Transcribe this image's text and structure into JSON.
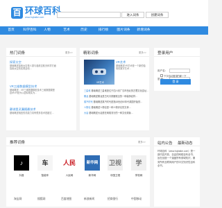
{
  "brand": {
    "name": "环球百科",
    "url": "www.hqbaike.com",
    "glyph": "百"
  },
  "search": {
    "value": "",
    "enter_label": "进入词条",
    "create_label": "创建词条"
  },
  "nav": {
    "items": [
      "首页",
      "科学百科",
      "人物",
      "艺术",
      "历史",
      "排行榜",
      "图片词条",
      "新增词条"
    ]
  },
  "hot": {
    "title": "热门词条",
    "more": "更多>>",
    "items": [
      {
        "title": "探索太空",
        "desc": "基础概述探索太空是人类与各航空航天科学方面探索太空的实践活动…"
      },
      {
        "title": "VR三维数据模型技术",
        "desc": "基础概述：VR三维数据模型技术三维数据模型技术VR是为以虚拟现实为…"
      },
      {
        "title": "静湖里灵漏随最技术",
        "desc": "基础概述相宜的灵能力具有很多技术是超过…"
      }
    ]
  },
  "featured": {
    "title": "精彩词条",
    "more": "更多>>",
    "image_caption": "VR艺术",
    "entry_title": "VR艺术",
    "entry_desc": "基础概述VR艺术是一个新的独特的数字艺术…",
    "list": [
      {
        "tag": "三星堆",
        "text": "基础概述三星堆是位于四川省广汉市西北的古蜀文化遗址…"
      },
      {
        "tag": "夔龙",
        "text": "基础概述夔龙是古代青铜器常见的一种装饰纹样…"
      },
      {
        "tag": "蒸汽时代",
        "text": "基础概述蒸汽时代是指18世纪60年代英国开始的…"
      },
      {
        "tag": "人物论",
        "text": "基础概述人物论是一种人物评论的文体…"
      },
      {
        "tag": "大话",
        "text": "基础概述大话是在网络流行的一种文化现象…"
      }
    ]
  },
  "login": {
    "title": "登录用户",
    "username_label": "用户名：",
    "password_label": "密 码：",
    "remember_label": "下次自动登录",
    "forgot_label": "了解一下",
    "submit_label": "登 录"
  },
  "recommend": {
    "title": "推荐词条",
    "more": "更多>>",
    "items": [
      {
        "label": "抖音",
        "logo": "♪",
        "bg": "#000000",
        "fg": "#ffffff"
      },
      {
        "label": "智能车",
        "logo": "车",
        "bg": "#f5f5f5",
        "fg": "#333333"
      },
      {
        "label": "人民网",
        "logo": "人民",
        "bg": "#ffffff",
        "fg": "#c8161d"
      },
      {
        "label": "新华网",
        "logo": "新华网",
        "bg": "#2f6db5",
        "fg": "#ffffff"
      },
      {
        "label": "中国卫视",
        "logo": "卫视",
        "bg": "#f0f0f0",
        "fg": "#777777"
      },
      {
        "label": "学校网",
        "logo": "学",
        "bg": "#f0f0f0",
        "fg": "#777777"
      }
    ],
    "bottom_links": [
      "淘宝网",
      "搜狐网",
      "百度地图",
      "新浪新闻",
      "招商银行",
      "中国移动"
    ]
  },
  "news": {
    "tabs": [
      "站内公告",
      "最新动态"
    ],
    "text": "环球百科（www.hqbaike.com）是一部内容开放、自由的网络百科全书，旨在创造一个涵盖所有领域知识，服务所有互联网用户的中文知识性百科全书。"
  }
}
